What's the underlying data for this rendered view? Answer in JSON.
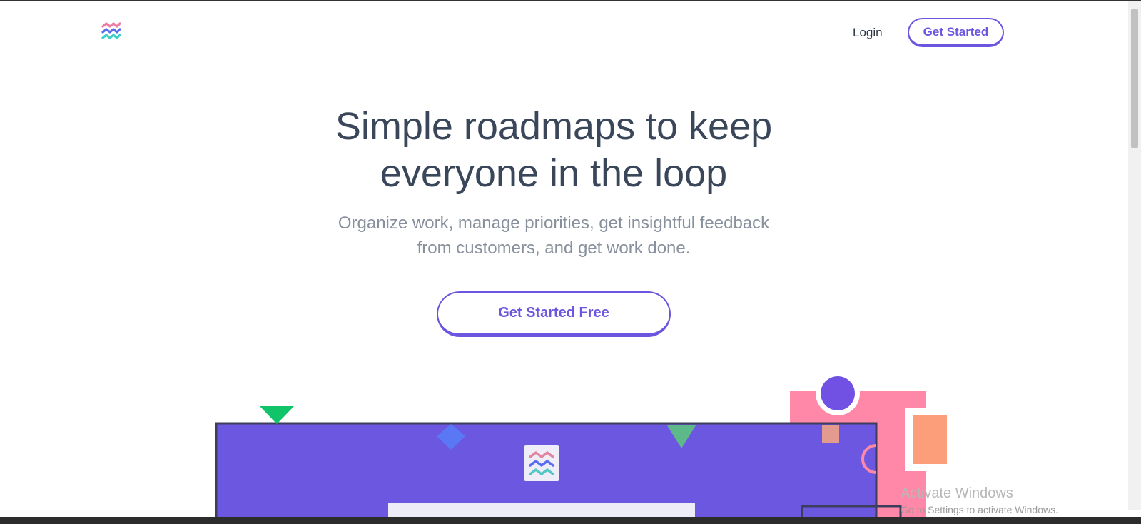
{
  "header": {
    "login_label": "Login",
    "cta_label": "Get Started"
  },
  "hero": {
    "headline_line1": "Simple roadmaps to keep",
    "headline_line2": "everyone in the loop",
    "subhead_line1": "Organize work, manage priorities, get insightful feedback",
    "subhead_line2": "from customers, and get work done.",
    "cta_label": "Get Started Free"
  },
  "watermark": {
    "title": "Activate Windows",
    "subtitle": "Go to Settings to activate Windows."
  },
  "icons": {
    "logo": "wave-logo-icon"
  },
  "colors": {
    "accent": "#6c56df",
    "headline": "#3a4659",
    "subtext": "#87909c",
    "wave_pink": "#f07aa0",
    "wave_blue": "#5a6df0",
    "wave_teal": "#3cd0c4",
    "panel_pink": "#ff88a8",
    "green": "#12c469",
    "orange": "#fd9e7a"
  }
}
